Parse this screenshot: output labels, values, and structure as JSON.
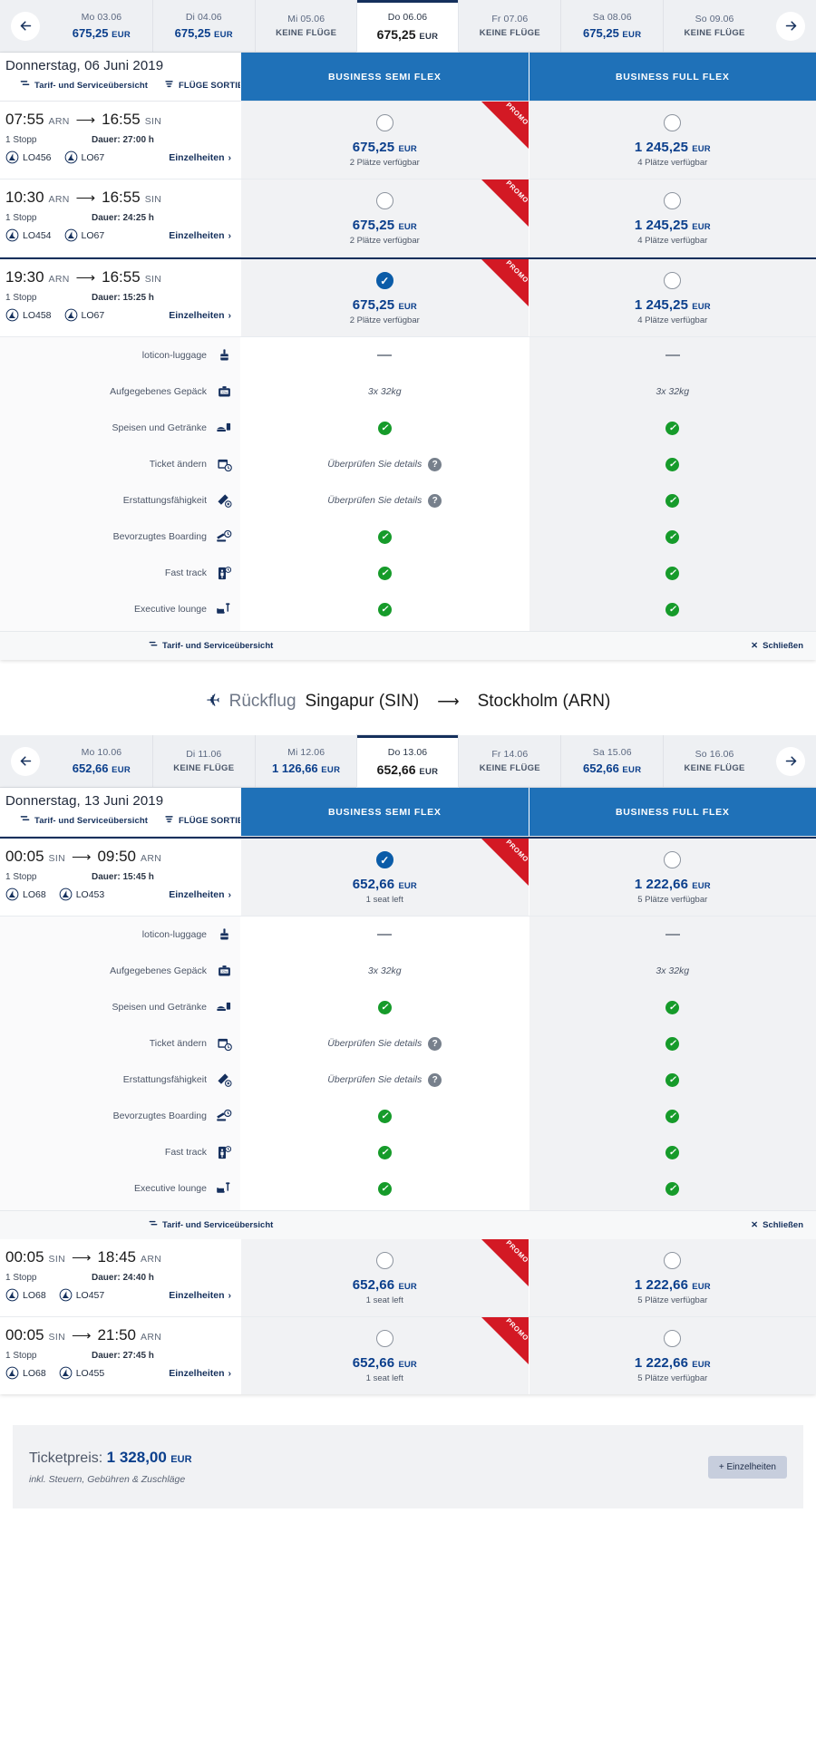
{
  "outbound": {
    "datestrip": {
      "prev_icon": "arrow-left-icon",
      "next_icon": "arrow-right-icon",
      "cells": [
        {
          "day": "Mo 03.06",
          "price": "675,25",
          "currency": "EUR",
          "selected": false
        },
        {
          "day": "Di 04.06",
          "price": "675,25",
          "currency": "EUR",
          "selected": false
        },
        {
          "day": "Mi 05.06",
          "no_flights": "KEINE FLÜGE",
          "selected": false
        },
        {
          "day": "Do 06.06",
          "price": "675,25",
          "currency": "EUR",
          "selected": true
        },
        {
          "day": "Fr 07.06",
          "no_flights": "KEINE FLÜGE",
          "selected": false
        },
        {
          "day": "Sa 08.06",
          "price": "675,25",
          "currency": "EUR",
          "selected": false
        },
        {
          "day": "So 09.06",
          "no_flights": "KEINE FLÜGE",
          "selected": false
        }
      ]
    },
    "header": {
      "date": "Donnerstag, 06 Juni 2019",
      "link_overview": "Tarif- und Serviceübersicht",
      "link_sort": "FLÜGE SORTIEREN",
      "fare1": "BUSINESS SEMI FLEX",
      "fare2": "BUSINESS FULL FLEX"
    },
    "flights": [
      {
        "dep_time": "07:55",
        "dep_code": "ARN",
        "arr_time": "16:55",
        "arr_code": "SIN",
        "stops": "1 Stopp",
        "duration": "Dauer: 27:00 h",
        "flight1": "LO456",
        "flight2": "LO67",
        "details": "Einzelheiten",
        "selected": false,
        "fares": [
          {
            "price": "675,25",
            "currency": "EUR",
            "seats": "2 Plätze verfügbar",
            "selected": false,
            "promo": "PROMO"
          },
          {
            "price": "1 245,25",
            "currency": "EUR",
            "seats": "4 Plätze verfügbar",
            "selected": false,
            "promo": ""
          }
        ]
      },
      {
        "dep_time": "10:30",
        "dep_code": "ARN",
        "arr_time": "16:55",
        "arr_code": "SIN",
        "stops": "1 Stopp",
        "duration": "Dauer: 24:25 h",
        "flight1": "LO454",
        "flight2": "LO67",
        "details": "Einzelheiten",
        "selected": false,
        "fares": [
          {
            "price": "675,25",
            "currency": "EUR",
            "seats": "2 Plätze verfügbar",
            "selected": false,
            "promo": "PROMO"
          },
          {
            "price": "1 245,25",
            "currency": "EUR",
            "seats": "4 Plätze verfügbar",
            "selected": false,
            "promo": ""
          }
        ]
      },
      {
        "dep_time": "19:30",
        "dep_code": "ARN",
        "arr_time": "16:55",
        "arr_code": "SIN",
        "stops": "1 Stopp",
        "duration": "Dauer: 15:25 h",
        "flight1": "LO458",
        "flight2": "LO67",
        "details": "Einzelheiten",
        "selected": true,
        "fares": [
          {
            "price": "675,25",
            "currency": "EUR",
            "seats": "2 Plätze verfügbar",
            "selected": true,
            "promo": "PROMO"
          },
          {
            "price": "1 245,25",
            "currency": "EUR",
            "seats": "4 Plätze verfügbar",
            "selected": false,
            "promo": ""
          }
        ]
      }
    ],
    "amenities": {
      "rows": [
        {
          "label": "loticon-luggage",
          "icon": "cabin-luggage-icon",
          "semi": {
            "type": "dash"
          },
          "full": {
            "type": "dash"
          }
        },
        {
          "label": "Aufgegebenes Gepäck",
          "icon": "checked-baggage-icon",
          "semi": {
            "type": "text",
            "text": "3x 32kg"
          },
          "full": {
            "type": "text",
            "text": "3x 32kg"
          }
        },
        {
          "label": "Speisen und Getränke",
          "icon": "meal-icon",
          "semi": {
            "type": "tick"
          },
          "full": {
            "type": "tick"
          }
        },
        {
          "label": "Ticket ändern",
          "icon": "calendar-change-icon",
          "semi": {
            "type": "check-details",
            "text": "Überprüfen Sie details"
          },
          "full": {
            "type": "tick"
          }
        },
        {
          "label": "Erstattungsfähigkeit",
          "icon": "refund-ticket-icon",
          "semi": {
            "type": "check-details",
            "text": "Überprüfen Sie details"
          },
          "full": {
            "type": "tick"
          }
        },
        {
          "label": "Bevorzugtes Boarding",
          "icon": "priority-boarding-icon",
          "semi": {
            "type": "tick"
          },
          "full": {
            "type": "tick"
          }
        },
        {
          "label": "Fast track",
          "icon": "fast-track-icon",
          "semi": {
            "type": "tick"
          },
          "full": {
            "type": "tick"
          }
        },
        {
          "label": "Executive lounge",
          "icon": "lounge-icon",
          "semi": {
            "type": "tick"
          },
          "full": {
            "type": "tick"
          }
        }
      ]
    },
    "footer": {
      "overview": "Tarif- und Serviceübersicht",
      "close": "Schließen"
    }
  },
  "return_heading": {
    "plane_icon": "airplane-icon",
    "label": "Rückflug",
    "from": "Singapur (SIN)",
    "arrow": "⟶",
    "to": "Stockholm (ARN)"
  },
  "inbound": {
    "datestrip": {
      "prev_icon": "arrow-left-icon",
      "next_icon": "arrow-right-icon",
      "cells": [
        {
          "day": "Mo 10.06",
          "price": "652,66",
          "currency": "EUR",
          "selected": false
        },
        {
          "day": "Di 11.06",
          "no_flights": "KEINE FLÜGE",
          "selected": false
        },
        {
          "day": "Mi 12.06",
          "price": "1 126,66",
          "currency": "EUR",
          "selected": false
        },
        {
          "day": "Do 13.06",
          "price": "652,66",
          "currency": "EUR",
          "selected": true
        },
        {
          "day": "Fr 14.06",
          "no_flights": "KEINE FLÜGE",
          "selected": false
        },
        {
          "day": "Sa 15.06",
          "price": "652,66",
          "currency": "EUR",
          "selected": false
        },
        {
          "day": "So 16.06",
          "no_flights": "KEINE FLÜGE",
          "selected": false
        }
      ]
    },
    "header": {
      "date": "Donnerstag, 13 Juni 2019",
      "link_overview": "Tarif- und Serviceübersicht",
      "link_sort": "FLÜGE SORTIEREN",
      "fare1": "BUSINESS SEMI FLEX",
      "fare2": "BUSINESS FULL FLEX"
    },
    "flights_top": [
      {
        "dep_time": "00:05",
        "dep_code": "SIN",
        "arr_time": "09:50",
        "arr_code": "ARN",
        "stops": "1 Stopp",
        "duration": "Dauer: 15:45 h",
        "flight1": "LO68",
        "flight2": "LO453",
        "details": "Einzelheiten",
        "selected": true,
        "fares": [
          {
            "price": "652,66",
            "currency": "EUR",
            "seats": "1 seat left",
            "selected": true,
            "promo": "PROMO"
          },
          {
            "price": "1 222,66",
            "currency": "EUR",
            "seats": "5 Plätze verfügbar",
            "selected": false,
            "promo": ""
          }
        ]
      }
    ],
    "amenities": {
      "rows": [
        {
          "label": "loticon-luggage",
          "icon": "cabin-luggage-icon",
          "semi": {
            "type": "dash"
          },
          "full": {
            "type": "dash"
          }
        },
        {
          "label": "Aufgegebenes Gepäck",
          "icon": "checked-baggage-icon",
          "semi": {
            "type": "text",
            "text": "3x 32kg"
          },
          "full": {
            "type": "text",
            "text": "3x 32kg"
          }
        },
        {
          "label": "Speisen und Getränke",
          "icon": "meal-icon",
          "semi": {
            "type": "tick"
          },
          "full": {
            "type": "tick"
          }
        },
        {
          "label": "Ticket ändern",
          "icon": "calendar-change-icon",
          "semi": {
            "type": "check-details",
            "text": "Überprüfen Sie details"
          },
          "full": {
            "type": "tick"
          }
        },
        {
          "label": "Erstattungsfähigkeit",
          "icon": "refund-ticket-icon",
          "semi": {
            "type": "check-details",
            "text": "Überprüfen Sie details"
          },
          "full": {
            "type": "tick"
          }
        },
        {
          "label": "Bevorzugtes Boarding",
          "icon": "priority-boarding-icon",
          "semi": {
            "type": "tick"
          },
          "full": {
            "type": "tick"
          }
        },
        {
          "label": "Fast track",
          "icon": "fast-track-icon",
          "semi": {
            "type": "tick"
          },
          "full": {
            "type": "tick"
          }
        },
        {
          "label": "Executive lounge",
          "icon": "lounge-icon",
          "semi": {
            "type": "tick"
          },
          "full": {
            "type": "tick"
          }
        }
      ]
    },
    "footer": {
      "overview": "Tarif- und Serviceübersicht",
      "close": "Schließen"
    },
    "flights_bottom": [
      {
        "dep_time": "00:05",
        "dep_code": "SIN",
        "arr_time": "18:45",
        "arr_code": "ARN",
        "stops": "1 Stopp",
        "duration": "Dauer: 24:40 h",
        "flight1": "LO68",
        "flight2": "LO457",
        "details": "Einzelheiten",
        "selected": false,
        "fares": [
          {
            "price": "652,66",
            "currency": "EUR",
            "seats": "1 seat left",
            "selected": false,
            "promo": "PROMO"
          },
          {
            "price": "1 222,66",
            "currency": "EUR",
            "seats": "5 Plätze verfügbar",
            "selected": false,
            "promo": ""
          }
        ]
      },
      {
        "dep_time": "00:05",
        "dep_code": "SIN",
        "arr_time": "21:50",
        "arr_code": "ARN",
        "stops": "1 Stopp",
        "duration": "Dauer: 27:45 h",
        "flight1": "LO68",
        "flight2": "LO455",
        "details": "Einzelheiten",
        "selected": false,
        "fares": [
          {
            "price": "652,66",
            "currency": "EUR",
            "seats": "1 seat left",
            "selected": false,
            "promo": "PROMO"
          },
          {
            "price": "1 222,66",
            "currency": "EUR",
            "seats": "5 Plätze verfügbar",
            "selected": false,
            "promo": ""
          }
        ]
      }
    ]
  },
  "total": {
    "label": "Ticketpreis:",
    "amount": "1 328,00",
    "currency": "EUR",
    "note": "inkl. Steuern, Gebühren & Zuschläge",
    "details_button": "+ Einzelheiten"
  },
  "colors": {
    "brand_navy": "#15305c",
    "fare_header_blue": "#1f71b8",
    "price_blue": "#0b3f8c",
    "promo_red": "#d31924",
    "tick_green": "#169b2a",
    "panel_grey": "#f1f2f4"
  }
}
